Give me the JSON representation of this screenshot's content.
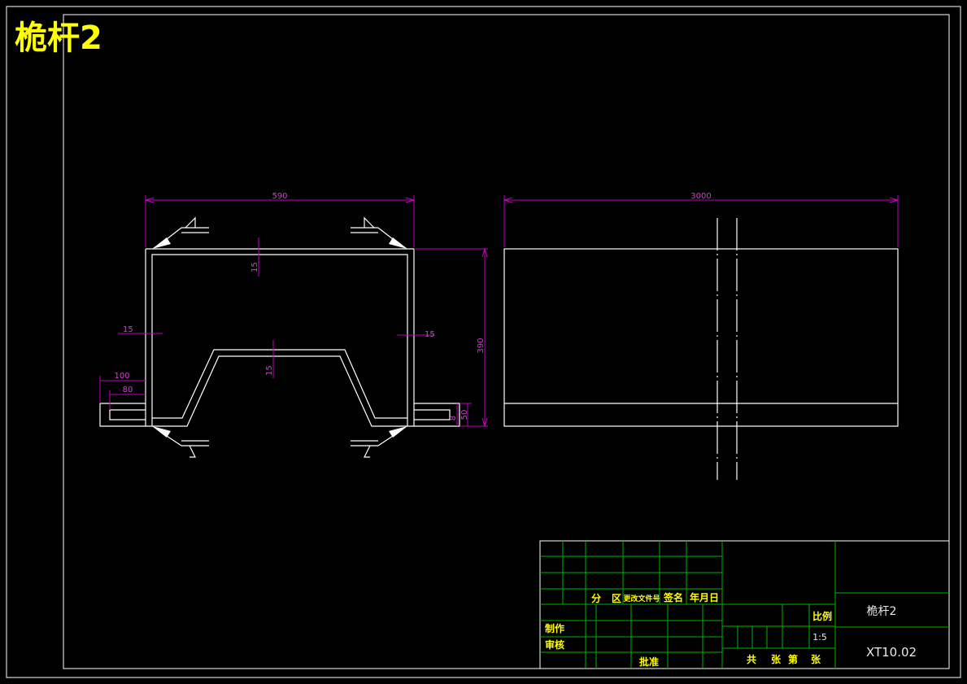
{
  "drawing_title": "桅杆2",
  "dimensions": {
    "overall_width": "590",
    "overall_length": "3000",
    "height": "390",
    "top_plate_thickness": "15",
    "left_wall_thickness": "15",
    "right_wall_thickness": "15",
    "center_plate_thickness": "15",
    "flange_outer": "100",
    "flange_inner": "80",
    "flange_small": "8",
    "flange_height": "50"
  },
  "title_block": {
    "header_labels": [
      "分",
      "区",
      "更改文件号",
      "签名",
      "年月日"
    ],
    "drawn_by": "制作",
    "checked_by": "审核",
    "approved_by": "批准",
    "scale_label": "比例",
    "scale_value": "1:5",
    "sheet_total": "共",
    "sheet_mid": "张",
    "sheet_num": "第",
    "sheet_end": "张",
    "part_name": "桅杆2",
    "drawing_number": "XT10.02"
  }
}
